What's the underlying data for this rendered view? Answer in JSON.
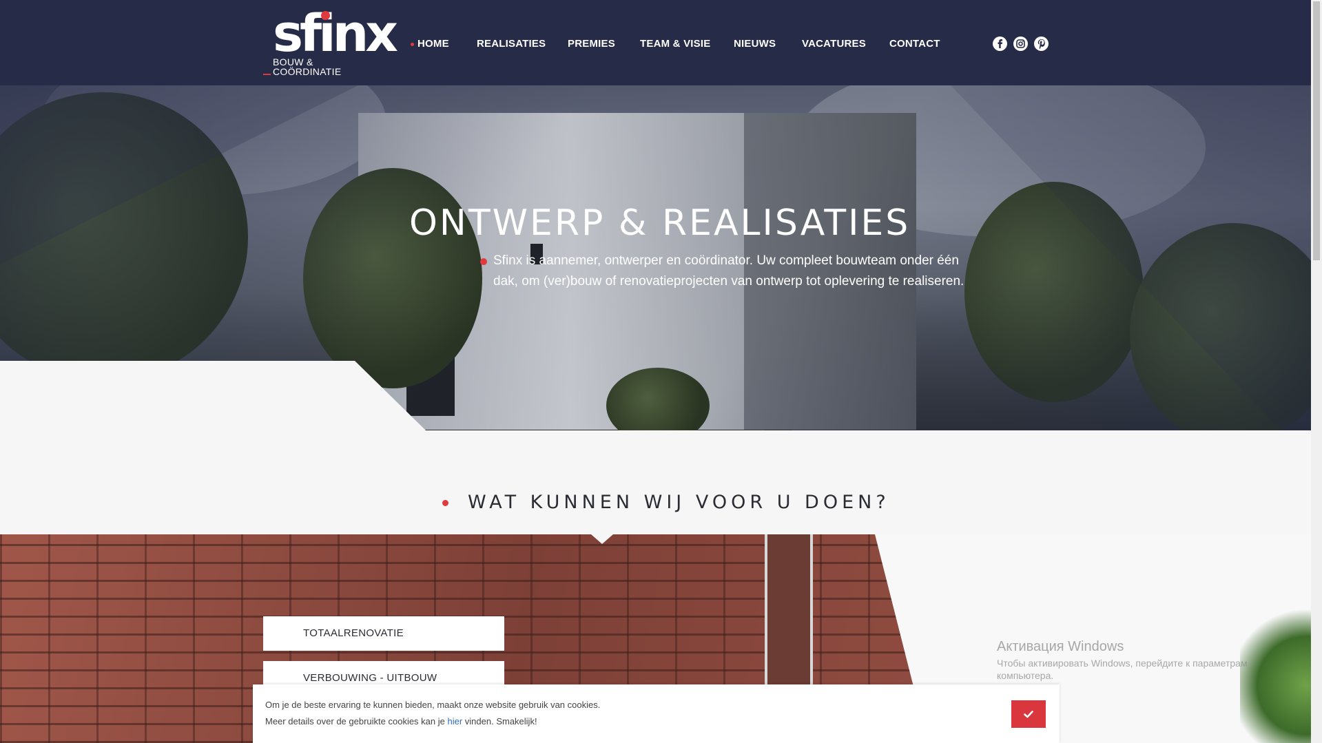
{
  "brand": {
    "logo_word": "sfinx",
    "logo_line1": "BOUW &",
    "logo_line2": "COÖRDINATIE",
    "accent_color": "#e03a3e",
    "header_color": "#262b47"
  },
  "nav": {
    "items": [
      {
        "label": "HOME",
        "active": true
      },
      {
        "label": "REALISATIES"
      },
      {
        "label": "PREMIES"
      },
      {
        "label": "TEAM & VISIE"
      },
      {
        "label": "NIEUWS"
      },
      {
        "label": "VACATURES"
      },
      {
        "label": "CONTACT"
      }
    ]
  },
  "social": [
    "facebook-icon",
    "instagram-icon",
    "pinterest-icon"
  ],
  "hero": {
    "title": "ONTWERP & REALISATIES",
    "text": "Sfinx is aannemer, ontwerper en coördinator. Uw compleet bouwteam onder één dak, om (ver)bouw of renovatieprojecten van ontwerp tot oplevering te realiseren."
  },
  "services": {
    "title": "WAT KUNNEN WIJ VOOR U DOEN?",
    "items": [
      "TOTAALRENOVATIE",
      "VERBOUWING - UITBOUW"
    ]
  },
  "watermark": {
    "title": "Активация Windows",
    "text": "Чтобы активировать Windows, перейдите к параметрам компьютера."
  },
  "cookie": {
    "line1": "Om je de beste ervaring te kunnen bieden, maakt onze website gebruik van cookies.",
    "line2_before": "Meer details over de gebruikte cookies kan je ",
    "line2_link": "hier",
    "line2_after": " vinden. Smakelijk!",
    "button_icon": "check-icon"
  }
}
